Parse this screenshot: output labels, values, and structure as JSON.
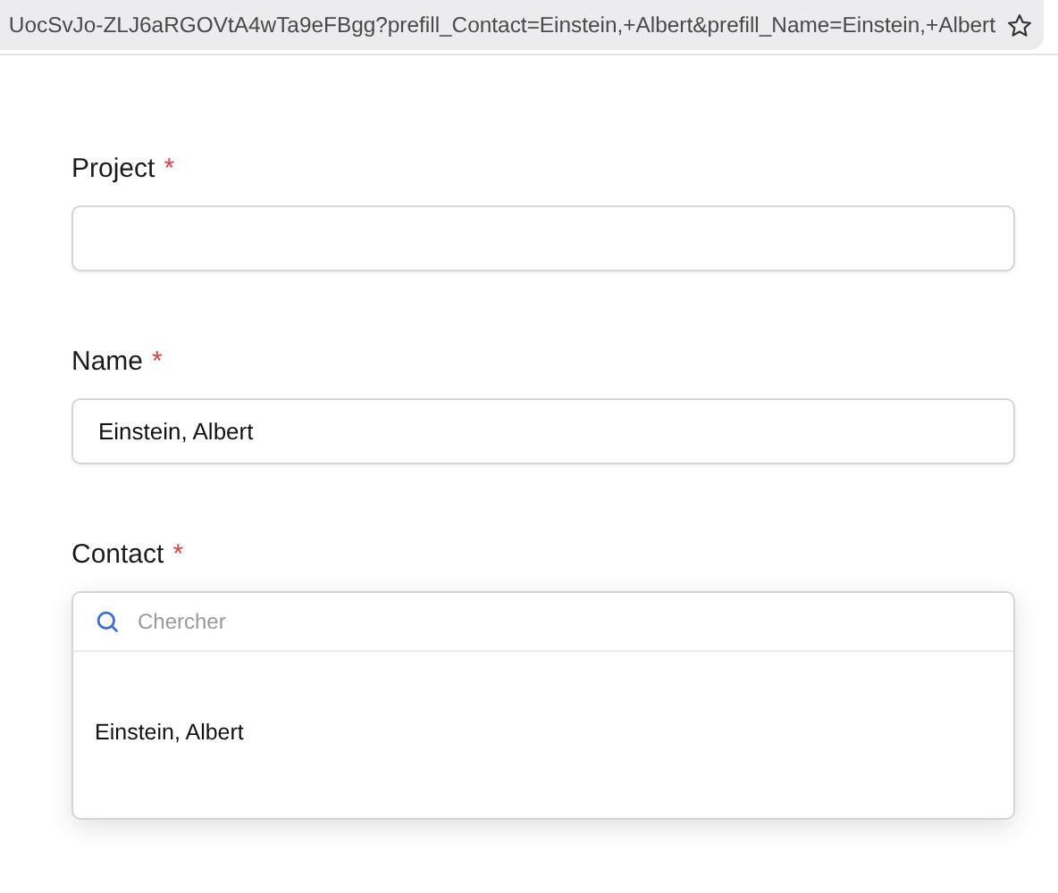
{
  "address_bar": {
    "url": "UocSvJo-ZLJ6aRGOVtA4wTa9eFBgg?prefill_Contact=Einstein,+Albert&prefill_Name=Einstein,+Albert"
  },
  "fields": [
    {
      "kind": "text",
      "label": "Project",
      "required_mark": "*"
    },
    {
      "kind": "text",
      "label": "Name",
      "required_mark": "*",
      "value": "Einstein, Albert"
    },
    {
      "kind": "dropdown",
      "label": "Contact",
      "required_mark": "*",
      "search_placeholder": "Chercher",
      "options": [
        "Einstein, Albert"
      ]
    }
  ]
}
